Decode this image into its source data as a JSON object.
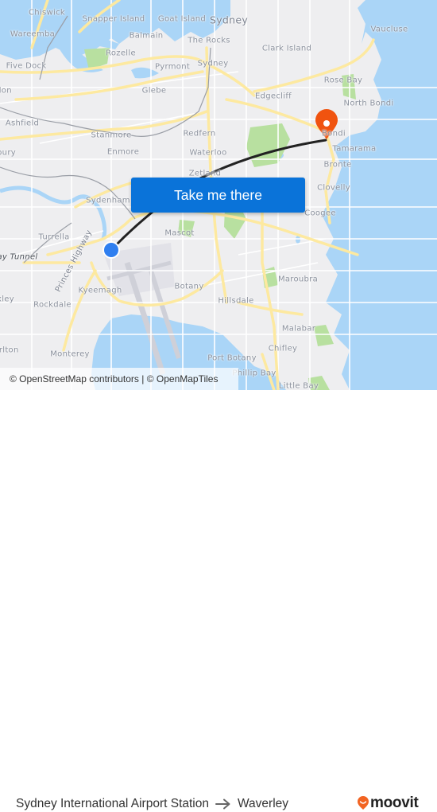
{
  "map": {
    "colors": {
      "land": "#eeeef0",
      "water": "#aad5f7",
      "park": "#b8e0a0",
      "road_major": "#fde9a0",
      "road_minor": "#ffffff",
      "rail": "#9a9ea6",
      "route_line": "#222222",
      "origin_marker": "#2f7ff0",
      "destination_marker": "#f0530f"
    },
    "labels": [
      {
        "text": "Chiswick",
        "cls": ""
      },
      {
        "text": "Snapper Island",
        "cls": ""
      },
      {
        "text": "Goat Island",
        "cls": ""
      },
      {
        "text": "Sydney",
        "cls": "big"
      },
      {
        "text": "Vaucluse",
        "cls": ""
      },
      {
        "text": "Wareemba",
        "cls": ""
      },
      {
        "text": "Balmain",
        "cls": ""
      },
      {
        "text": "The Rocks",
        "cls": ""
      },
      {
        "text": "Clark Island",
        "cls": ""
      },
      {
        "text": "Rozelle",
        "cls": ""
      },
      {
        "text": "Five Dock",
        "cls": ""
      },
      {
        "text": "Pyrmont",
        "cls": ""
      },
      {
        "text": "Sydney",
        "cls": ""
      },
      {
        "text": "Rose Bay",
        "cls": ""
      },
      {
        "text": "don",
        "cls": ""
      },
      {
        "text": "Glebe",
        "cls": ""
      },
      {
        "text": "Edgecliff",
        "cls": ""
      },
      {
        "text": "North Bondi",
        "cls": ""
      },
      {
        "text": "Ashfield",
        "cls": ""
      },
      {
        "text": "Stanmore",
        "cls": ""
      },
      {
        "text": "Redfern",
        "cls": ""
      },
      {
        "text": "Bondi",
        "cls": ""
      },
      {
        "text": "bury",
        "cls": ""
      },
      {
        "text": "Enmore",
        "cls": ""
      },
      {
        "text": "Waterloo",
        "cls": ""
      },
      {
        "text": "Tamarama",
        "cls": ""
      },
      {
        "text": "Zetland",
        "cls": ""
      },
      {
        "text": "Bronte",
        "cls": ""
      },
      {
        "text": "Clovelly",
        "cls": ""
      },
      {
        "text": "Sydenham",
        "cls": ""
      },
      {
        "text": "Coogee",
        "cls": ""
      },
      {
        "text": "Turrella",
        "cls": ""
      },
      {
        "text": "Mascot",
        "cls": ""
      },
      {
        "text": "ay Tunnel",
        "cls": "it"
      },
      {
        "text": "Princes Highway",
        "cls": "rot"
      },
      {
        "text": "Kyeemagh",
        "cls": ""
      },
      {
        "text": "Botany",
        "cls": ""
      },
      {
        "text": "Maroubra",
        "cls": ""
      },
      {
        "text": "Hillsdale",
        "cls": ""
      },
      {
        "text": "xley",
        "cls": ""
      },
      {
        "text": "Rockdale",
        "cls": ""
      },
      {
        "text": "Malabar",
        "cls": ""
      },
      {
        "text": "arlton",
        "cls": ""
      },
      {
        "text": "Monterey",
        "cls": ""
      },
      {
        "text": "Chifley",
        "cls": ""
      },
      {
        "text": "Port Botany",
        "cls": ""
      },
      {
        "text": "Phillip Bay",
        "cls": ""
      },
      {
        "text": "Little Bay",
        "cls": ""
      }
    ],
    "origin_marker": {
      "name": "Sydney International Airport Station"
    },
    "destination_marker": {
      "name": "Waverley"
    }
  },
  "cta": {
    "label": "Take me there"
  },
  "attribution": "© OpenStreetMap contributors | © OpenMapTiles",
  "footer": {
    "origin": "Sydney International Airport Station",
    "arrow": "arrow-right-icon",
    "destination": "Waverley",
    "brand": "moovit",
    "brand_color": "#f26422"
  }
}
